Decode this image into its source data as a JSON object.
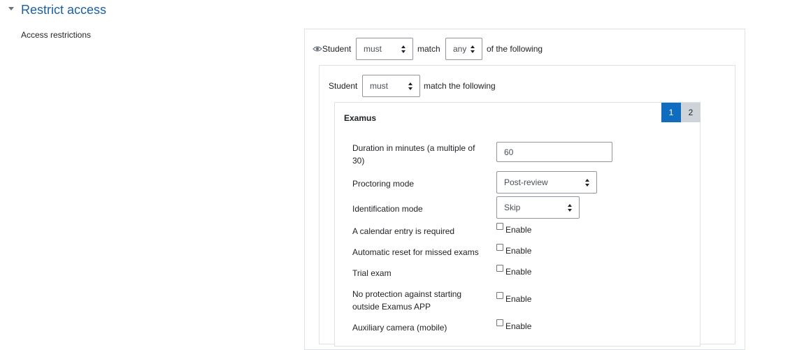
{
  "section": {
    "title": "Restrict access",
    "access_label": "Access restrictions"
  },
  "outer": {
    "student_label": "Student",
    "must_select": "must",
    "match_label": "match",
    "any_select": "any",
    "suffix": "of the following"
  },
  "inner": {
    "student_label": "Student",
    "must_select": "must",
    "suffix": "match the following"
  },
  "pagination": [
    "1",
    "2"
  ],
  "examus": {
    "title": "Examus",
    "duration_label": "Duration in minutes (a multiple of 30)",
    "duration_value": "60",
    "proctoring_label": "Proctoring mode",
    "proctoring_value": "Post-review",
    "identification_label": "Identification mode",
    "identification_value": "Skip",
    "checkbox_rows": [
      {
        "label": "A calendar entry is required",
        "option": "Enable"
      },
      {
        "label": "Automatic reset for missed exams",
        "option": "Enable"
      },
      {
        "label": "Trial exam",
        "option": "Enable"
      },
      {
        "label": "No protection against starting outside Examus APP",
        "option": "Enable"
      },
      {
        "label": "Auxiliary camera (mobile)",
        "option": "Enable"
      }
    ]
  }
}
